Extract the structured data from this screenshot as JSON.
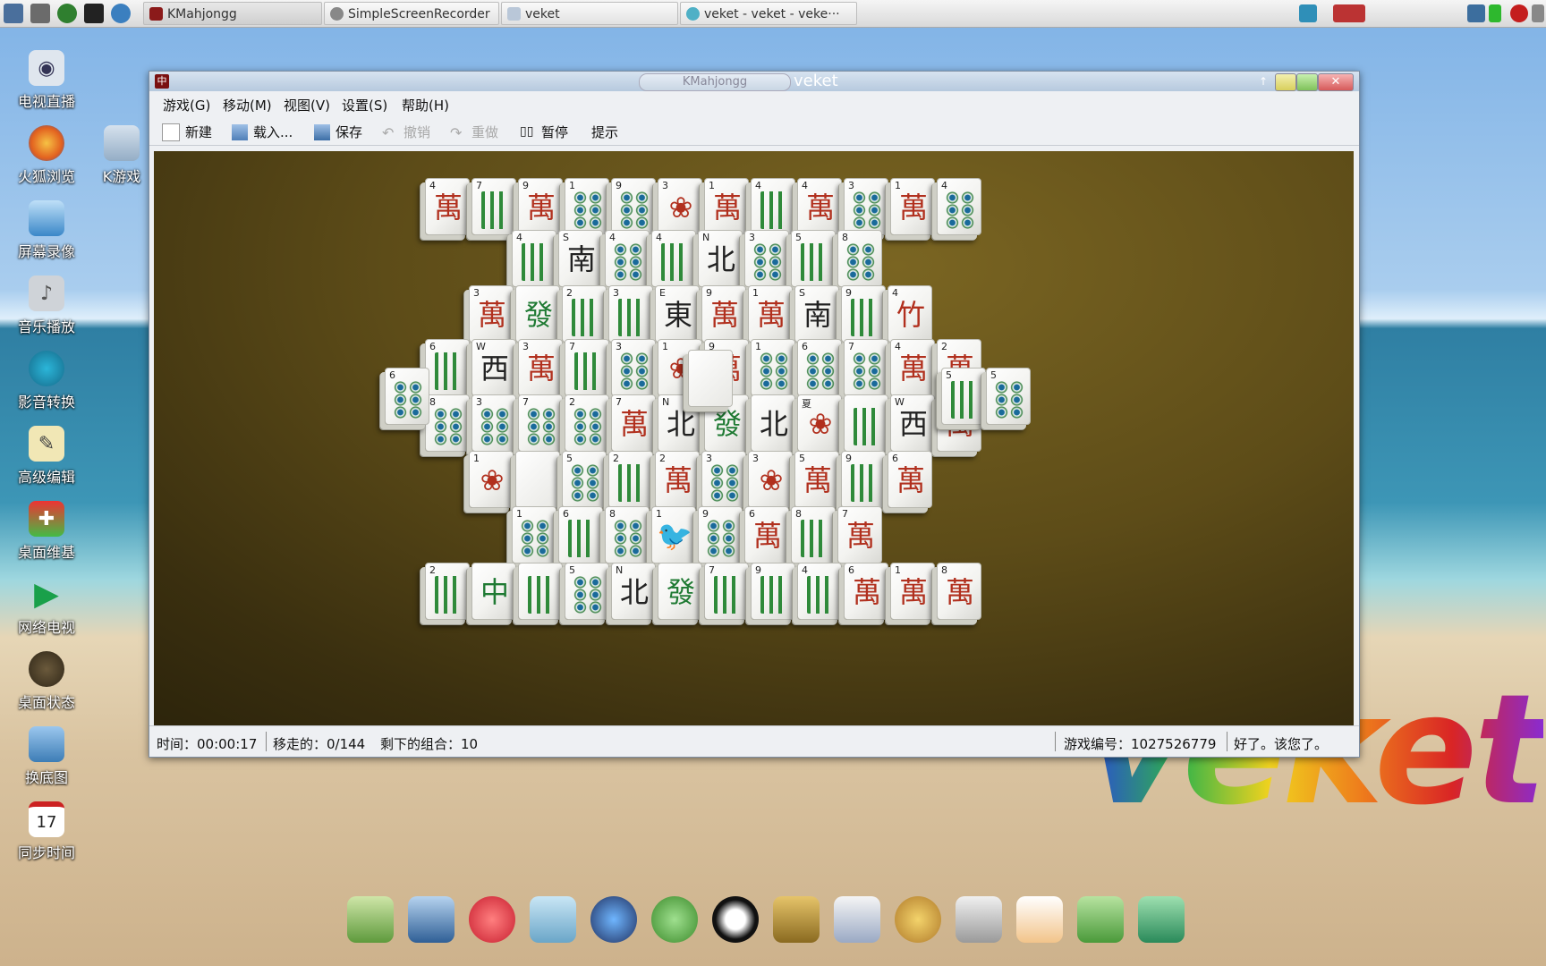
{
  "taskbar": {
    "tasks": [
      {
        "label": "KMahjongg"
      },
      {
        "label": "SimpleScreenRecorder"
      },
      {
        "label": "veket"
      },
      {
        "label": "veket - veket - veke···"
      }
    ]
  },
  "desktop_icons": [
    {
      "label": "电视直播",
      "icon": "tv-icon"
    },
    {
      "label": "火狐浏览",
      "icon": "firefox-icon"
    },
    {
      "label": "屏幕录像",
      "icon": "screen-recorder-icon"
    },
    {
      "label": "音乐播放",
      "icon": "music-icon"
    },
    {
      "label": "影音转换",
      "icon": "media-convert-icon"
    },
    {
      "label": "高级编辑",
      "icon": "editor-icon"
    },
    {
      "label": "桌面维基",
      "icon": "wiki-icon"
    },
    {
      "label": "网络电视",
      "icon": "play-icon"
    },
    {
      "label": "桌面状态",
      "icon": "status-icon"
    },
    {
      "label": "换底图",
      "icon": "wallpaper-icon"
    },
    {
      "label": "同步时间",
      "icon": "calendar-icon"
    },
    {
      "label": "K游戏",
      "icon": "folder-icon"
    }
  ],
  "calendar_day": "17",
  "window": {
    "tab_title": "KMahjongg",
    "title": "veket"
  },
  "menubar": [
    "游戏(G)",
    "移动(M)",
    "视图(V)",
    "设置(S)",
    "帮助(H)"
  ],
  "toolbar": {
    "new": "新建",
    "load": "载入...",
    "save": "保存",
    "undo": "撤销",
    "redo": "重做",
    "pause": "暂停",
    "hint": "提示"
  },
  "status": {
    "time": "时间：00:00:17",
    "moves": "移走的：0/144",
    "remaining": "剩下的组合：10",
    "game_no": "游戏编号：1027526779",
    "message": "好了。该您了。"
  },
  "wallpaper_text": "veket",
  "tiles": [
    {
      "n": "4",
      "g": "萬",
      "t": "char"
    },
    {
      "n": "7",
      "t": "bam"
    },
    {
      "n": "9",
      "g": "萬",
      "t": "char"
    },
    {
      "n": "1",
      "t": "dot"
    },
    {
      "n": "9",
      "t": "dot"
    },
    {
      "n": "3",
      "g": "❀",
      "t": "flower"
    },
    {
      "n": "1",
      "g": "萬",
      "t": "char"
    },
    {
      "n": "4",
      "t": "bam"
    },
    {
      "n": "4",
      "g": "萬",
      "t": "char"
    },
    {
      "n": "3",
      "t": "dot"
    },
    {
      "n": "1",
      "g": "萬",
      "t": "char"
    },
    {
      "n": "4",
      "t": "dot"
    },
    {
      "n": "4",
      "t": "bam"
    },
    {
      "n": "S",
      "g": "南",
      "t": "wind"
    },
    {
      "n": "4",
      "t": "dot"
    },
    {
      "n": "4",
      "t": "bam"
    },
    {
      "n": "N",
      "g": "北",
      "t": "wind"
    },
    {
      "n": "3",
      "t": "dot"
    },
    {
      "n": "5",
      "t": "bam"
    },
    {
      "n": "8",
      "t": "dot"
    },
    {
      "n": "3",
      "g": "萬",
      "t": "char"
    },
    {
      "n": "",
      "g": "發",
      "t": "dragon"
    },
    {
      "n": "2",
      "t": "bam"
    },
    {
      "n": "3",
      "t": "bam"
    },
    {
      "n": "E",
      "g": "東",
      "t": "wind"
    },
    {
      "n": "9",
      "g": "萬",
      "t": "char"
    },
    {
      "n": "1",
      "g": "萬",
      "t": "char"
    },
    {
      "n": "S",
      "g": "南",
      "t": "wind"
    },
    {
      "n": "9",
      "t": "bam"
    },
    {
      "n": "4",
      "g": "竹",
      "t": "flower"
    },
    {
      "n": "6",
      "t": "bam"
    },
    {
      "n": "W",
      "g": "西",
      "t": "wind"
    },
    {
      "n": "3",
      "g": "萬",
      "t": "char"
    },
    {
      "n": "7",
      "t": "bam"
    },
    {
      "n": "3",
      "t": "dot"
    },
    {
      "n": "1",
      "g": "❀",
      "t": "flower"
    },
    {
      "n": "9",
      "g": "萬",
      "t": "char"
    },
    {
      "n": "1",
      "t": "dot"
    },
    {
      "n": "6",
      "t": "dot"
    },
    {
      "n": "7",
      "t": "dot"
    },
    {
      "n": "4",
      "g": "萬",
      "t": "char"
    },
    {
      "n": "2",
      "g": "萬",
      "t": "char"
    },
    {
      "n": "8",
      "t": "dot"
    },
    {
      "n": "3",
      "t": "dot"
    },
    {
      "n": "7",
      "t": "dot"
    },
    {
      "n": "2",
      "t": "dot"
    },
    {
      "n": "7",
      "g": "萬",
      "t": "char"
    },
    {
      "n": "N",
      "g": "北",
      "t": "wind"
    },
    {
      "n": "",
      "g": "發",
      "t": "dragon"
    },
    {
      "n": "",
      "g": "北",
      "t": "wind"
    },
    {
      "n": "夏",
      "g": "❀",
      "t": "flower"
    },
    {
      "n": "",
      "t": "bam"
    },
    {
      "n": "W",
      "g": "西",
      "t": "wind"
    },
    {
      "n": "3",
      "g": "萬",
      "t": "char"
    },
    {
      "n": "1",
      "g": "❀",
      "t": "flower"
    },
    {
      "n": "",
      "t": "blank"
    },
    {
      "n": "5",
      "t": "dot"
    },
    {
      "n": "2",
      "t": "bam"
    },
    {
      "n": "2",
      "g": "萬",
      "t": "char"
    },
    {
      "n": "3",
      "t": "dot"
    },
    {
      "n": "3",
      "g": "❀",
      "t": "flower"
    },
    {
      "n": "5",
      "g": "萬",
      "t": "char"
    },
    {
      "n": "9",
      "t": "bam"
    },
    {
      "n": "6",
      "g": "萬",
      "t": "char"
    },
    {
      "n": "1",
      "t": "dot"
    },
    {
      "n": "6",
      "t": "bam"
    },
    {
      "n": "8",
      "t": "dot"
    },
    {
      "n": "1",
      "g": "🐦",
      "t": "bam"
    },
    {
      "n": "9",
      "t": "dot"
    },
    {
      "n": "6",
      "g": "萬",
      "t": "char"
    },
    {
      "n": "8",
      "t": "bam"
    },
    {
      "n": "7",
      "g": "萬",
      "t": "char"
    },
    {
      "n": "2",
      "t": "bam"
    },
    {
      "n": "",
      "g": "中",
      "t": "dragon"
    },
    {
      "n": "",
      "t": "bam"
    },
    {
      "n": "5",
      "t": "dot"
    },
    {
      "n": "N",
      "g": "北",
      "t": "wind"
    },
    {
      "n": "",
      "g": "發",
      "t": "dragon"
    },
    {
      "n": "7",
      "t": "bam"
    },
    {
      "n": "9",
      "t": "bam"
    },
    {
      "n": "4",
      "t": "bam"
    },
    {
      "n": "6",
      "g": "萬",
      "t": "char"
    },
    {
      "n": "1",
      "g": "萬",
      "t": "char"
    },
    {
      "n": "8",
      "g": "萬",
      "t": "char"
    },
    {
      "n": "6",
      "t": "dot"
    },
    {
      "n": "5",
      "t": "bam"
    },
    {
      "n": "5",
      "g": "萬",
      "t": "char"
    }
  ]
}
